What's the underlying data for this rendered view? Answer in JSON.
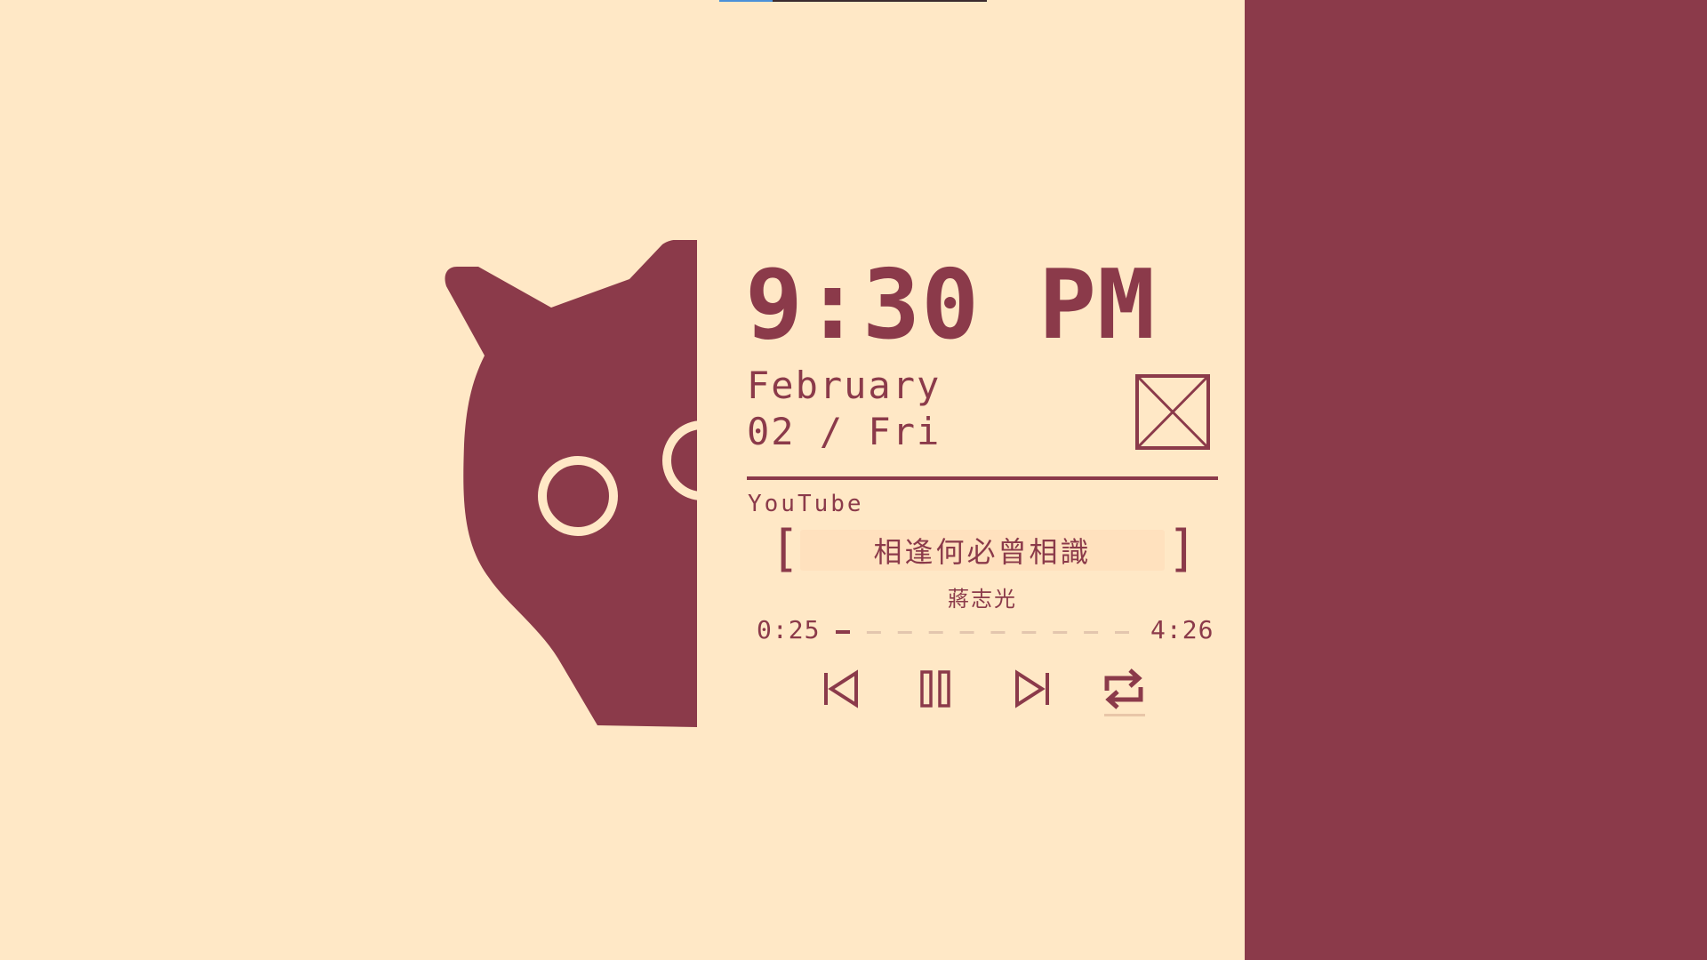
{
  "colors": {
    "background": "#FFE8C6",
    "accent": "#8B3A4A",
    "progress_inactive": "#E3C6AE"
  },
  "clock": {
    "time": "9:30 PM"
  },
  "date": {
    "month": "February",
    "day": "02 / Fri"
  },
  "album_art": {
    "icon": "placeholder-image-icon"
  },
  "player": {
    "source": "YouTube",
    "bracket_left": "[",
    "bracket_right": "]",
    "title": "相逢何必曾相識",
    "artist": "蔣志光",
    "current_time": "0:25",
    "total_time": "4:26",
    "progress": 0.098,
    "controls": {
      "previous": "skip-previous-icon",
      "pause": "pause-icon",
      "next": "skip-next-icon",
      "repeat": "repeat-icon"
    },
    "repeat_active": true
  }
}
